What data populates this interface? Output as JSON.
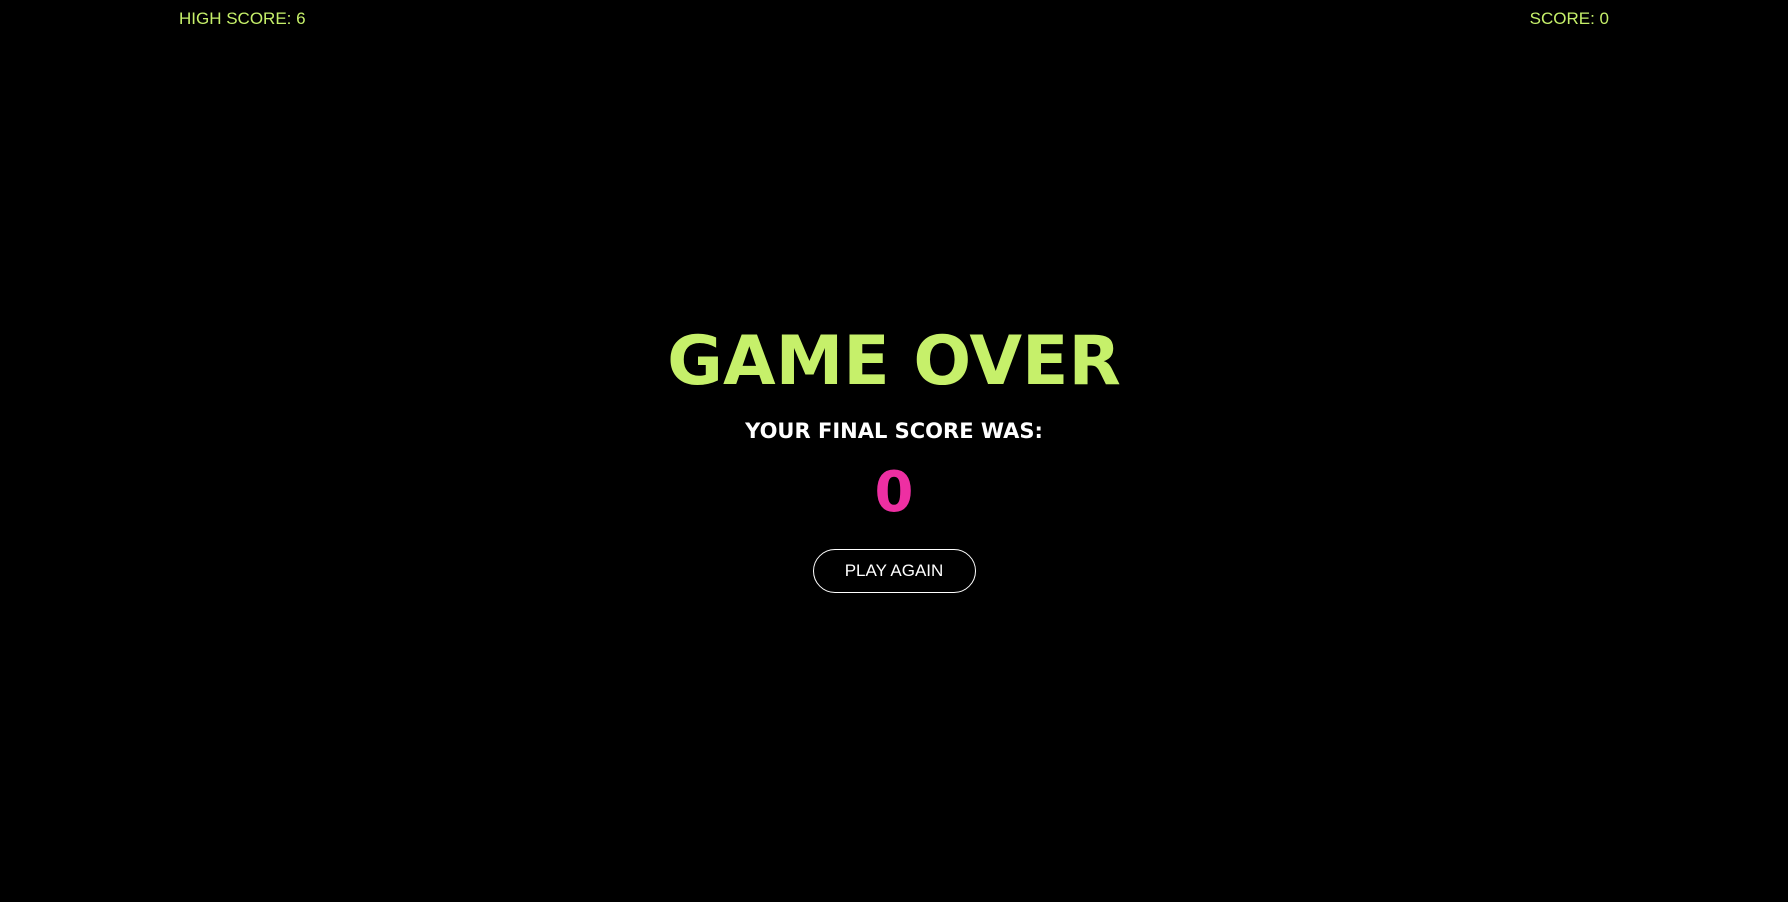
{
  "hud": {
    "high_score": "HIGH SCORE: 6",
    "score": "SCORE: 0"
  },
  "game_over": {
    "title": "GAME OVER",
    "subtitle": "YOUR FINAL SCORE WAS:",
    "final_score": "0",
    "play_again_label": "PLAY AGAIN"
  },
  "colors": {
    "background": "#000000",
    "accent_green": "#c6f06a",
    "score_pink": "#ee2fa2",
    "text_white": "#ffffff"
  }
}
